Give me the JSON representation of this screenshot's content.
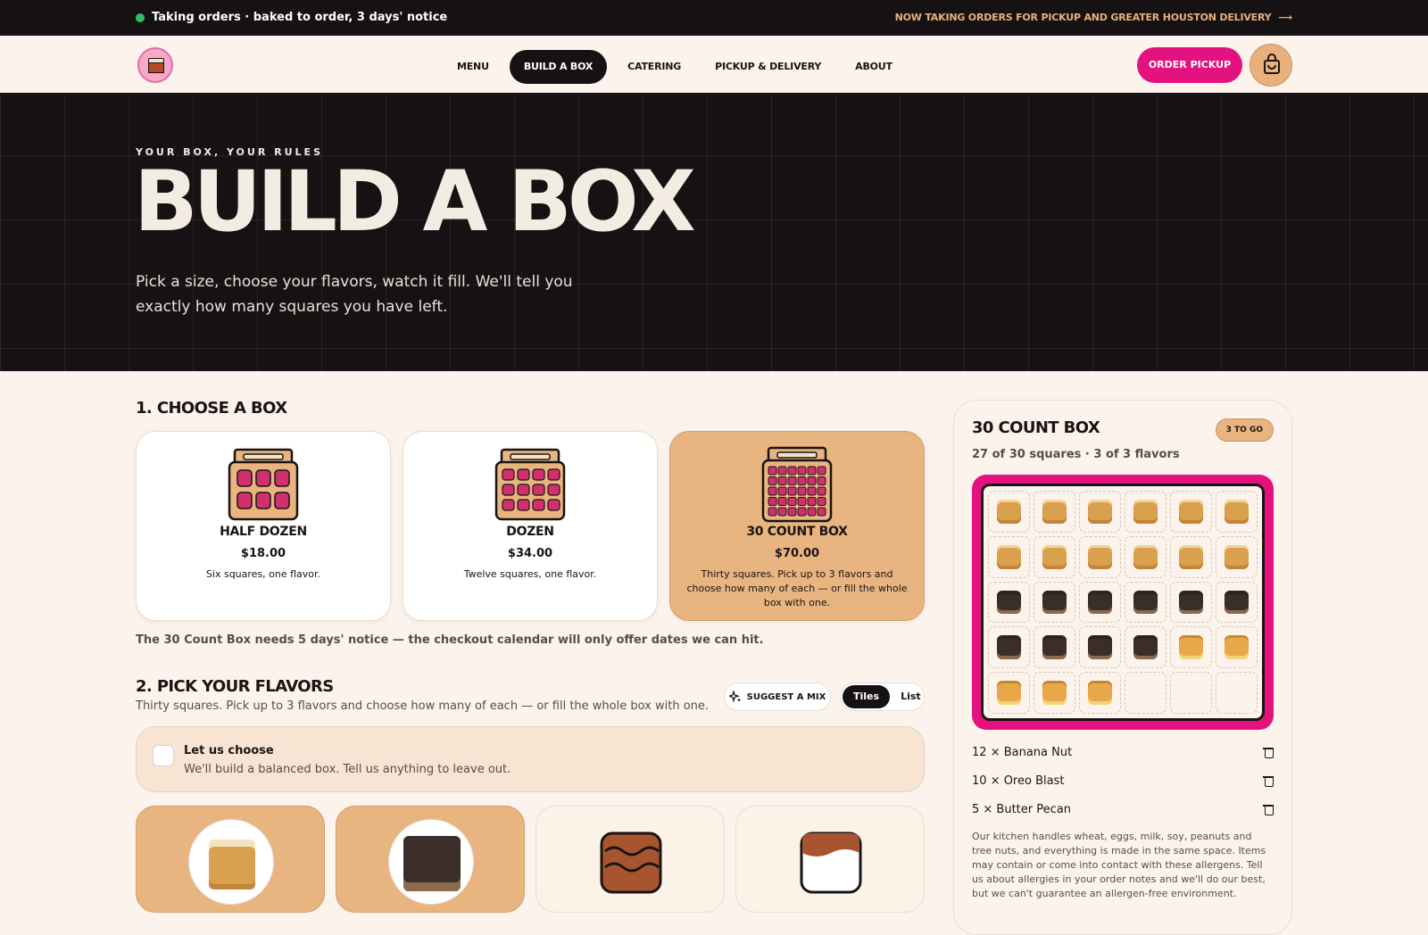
{
  "topbar": {
    "status": "Taking orders · baked to order, 3 days' notice",
    "promo": "NOW TAKING ORDERS FOR PICKUP AND GREATER HOUSTON DELIVERY",
    "promo_arrow": "⟶",
    "status_color": "#2fbf63"
  },
  "nav": {
    "items": [
      "MENU",
      "BUILD A BOX",
      "CATERING",
      "PICKUP & DELIVERY",
      "ABOUT"
    ],
    "active": "BUILD A BOX",
    "order_button": "ORDER PICKUP",
    "icons": {
      "logo": "cake-logo",
      "cart": "bag-icon"
    }
  },
  "hero": {
    "kicker": "YOUR BOX, YOUR RULES",
    "title": "BUILD A BOX",
    "subtitle": "Pick a size, choose your flavors, watch it fill. We'll tell you exactly how many squares you have left."
  },
  "choose": {
    "heading": "1. CHOOSE A BOX",
    "boxes": [
      {
        "name": "HALF DOZEN",
        "price": "$18.00",
        "desc": "Six squares, one flavor.",
        "selected": false
      },
      {
        "name": "DOZEN",
        "price": "$34.00",
        "desc": "Twelve squares, one flavor.",
        "selected": false
      },
      {
        "name": "30 COUNT BOX",
        "price": "$70.00",
        "desc": "Thirty squares. Pick up to 3 flavors and choose how many of each — or fill the whole box with one.",
        "selected": true
      }
    ],
    "notice": "The 30 Count Box needs 5 days' notice — the checkout calendar will only offer dates we can hit."
  },
  "flavors": {
    "heading": "2. PICK YOUR FLAVORS",
    "subtitle": "Thirty squares. Pick up to 3 flavors and choose how many of each — or fill the whole box with one.",
    "suggest_label": "SUGGEST A MIX",
    "view_options": [
      "Tiles",
      "List"
    ],
    "view_selected": "Tiles",
    "let_us_choose": {
      "title": "Let us choose",
      "subtitle": "We'll build a balanced box. Tell us anything to leave out.",
      "checked": false
    }
  },
  "summary": {
    "title": "30 COUNT BOX",
    "badge": "3 TO GO",
    "meta": "27 of 30 squares · 3 of 3 flavors",
    "filled": 27,
    "capacity": 30,
    "items": [
      {
        "label": "12 × Banana Nut",
        "key": "banana",
        "count": 12
      },
      {
        "label": "10 × Oreo Blast",
        "key": "oreo",
        "count": 10
      },
      {
        "label": "5 × Butter Pecan",
        "key": "pecan",
        "count": 5
      }
    ],
    "allergy": "Our kitchen handles wheat, eggs, milk, soy, peanuts and tree nuts, and everything is made in the same space. Items may contain or come into contact with these allergens. Tell us about allergies in your order notes and we'll do our best, but we can't guarantee an allergen-free environment."
  },
  "colors": {
    "accent": "#e4127e",
    "tan": "#e8b480",
    "dark": "#161213",
    "cream": "#fcf4ec"
  }
}
